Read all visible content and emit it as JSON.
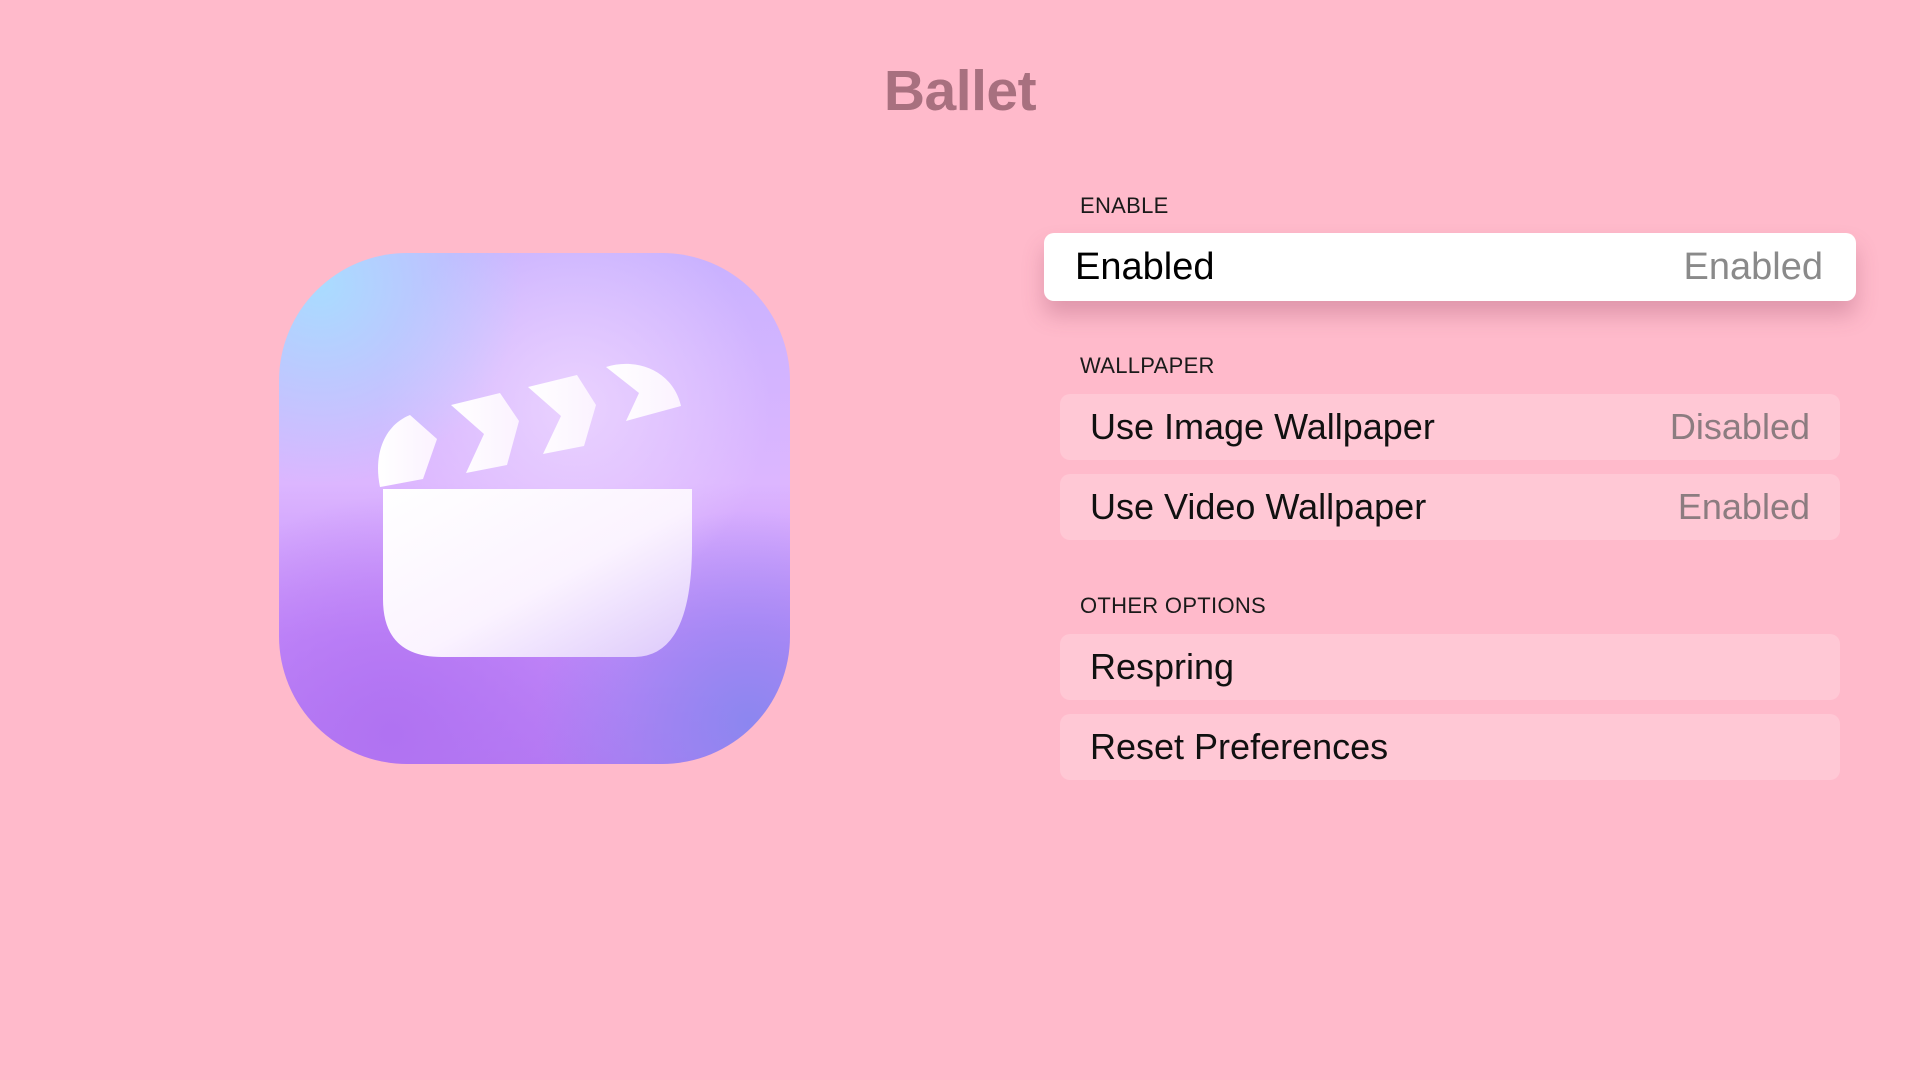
{
  "header": {
    "title": "Ballet"
  },
  "app_icon": {
    "icon": "clapperboard-icon",
    "colors": {
      "gradient_top_left": "#a9dcff",
      "gradient_mid": "#dcb6ff",
      "gradient_bottom": "#b77cf3",
      "glyph": "#ffffff"
    }
  },
  "sections": {
    "enable": {
      "header": "ENABLE",
      "rows": [
        {
          "label": "Enabled",
          "value": "Enabled",
          "focused": true
        }
      ]
    },
    "wallpaper": {
      "header": "WALLPAPER",
      "rows": [
        {
          "label": "Use Image Wallpaper",
          "value": "Disabled"
        },
        {
          "label": "Use Video Wallpaper",
          "value": "Enabled"
        }
      ]
    },
    "other_options": {
      "header": "OTHER OPTIONS",
      "rows": [
        {
          "label": "Respring"
        },
        {
          "label": "Reset Preferences"
        }
      ]
    }
  },
  "colors": {
    "background": "#ffbacb",
    "title": "#a8707f",
    "row_background": "#ffc8d5",
    "focused_row_background": "#ffffff",
    "value_text": "#8c7c80"
  }
}
